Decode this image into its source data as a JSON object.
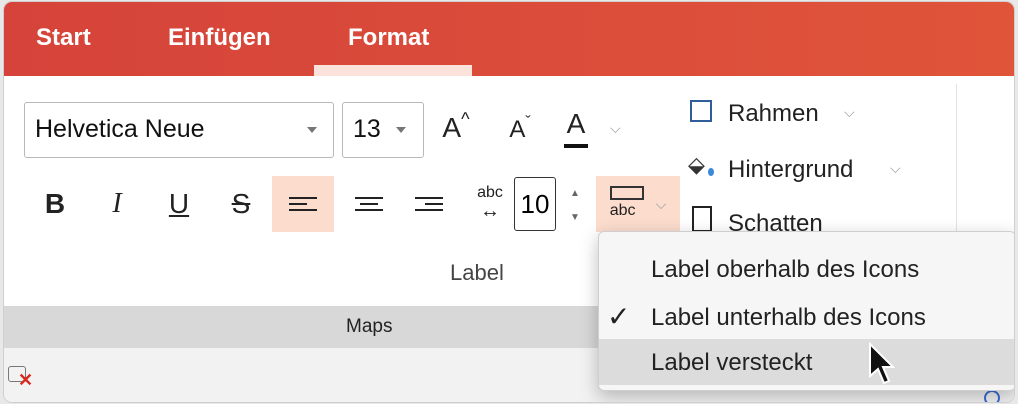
{
  "tabs": [
    {
      "label": "Start"
    },
    {
      "label": "Einfügen"
    },
    {
      "label": "Format"
    }
  ],
  "font": {
    "family_value": "Helvetica Neue",
    "size_value": "13",
    "grow_label": "A",
    "shrink_label": "A",
    "color_label": "A"
  },
  "format": {
    "bold": "B",
    "italic": "I",
    "underline": "U",
    "strike": "S",
    "abc": "abc",
    "spacing_value": "10",
    "label_pos_abc": "abc"
  },
  "side": {
    "border_label": "Rahmen",
    "background_label": "Hintergrund",
    "shadow_label": "Schatten"
  },
  "group_label": "Label",
  "maps_label": "Maps",
  "menu": {
    "items": [
      {
        "label": "Label oberhalb des Icons",
        "checked": false
      },
      {
        "label": "Label unterhalb des Icons",
        "checked": true
      },
      {
        "label": "Label versteckt",
        "checked": false,
        "highlighted": true
      }
    ],
    "check_glyph": "✓"
  },
  "colors": {
    "brand": "#d9493a",
    "active_bg": "#fbdccd",
    "remove_icon": "#d62b1f"
  }
}
